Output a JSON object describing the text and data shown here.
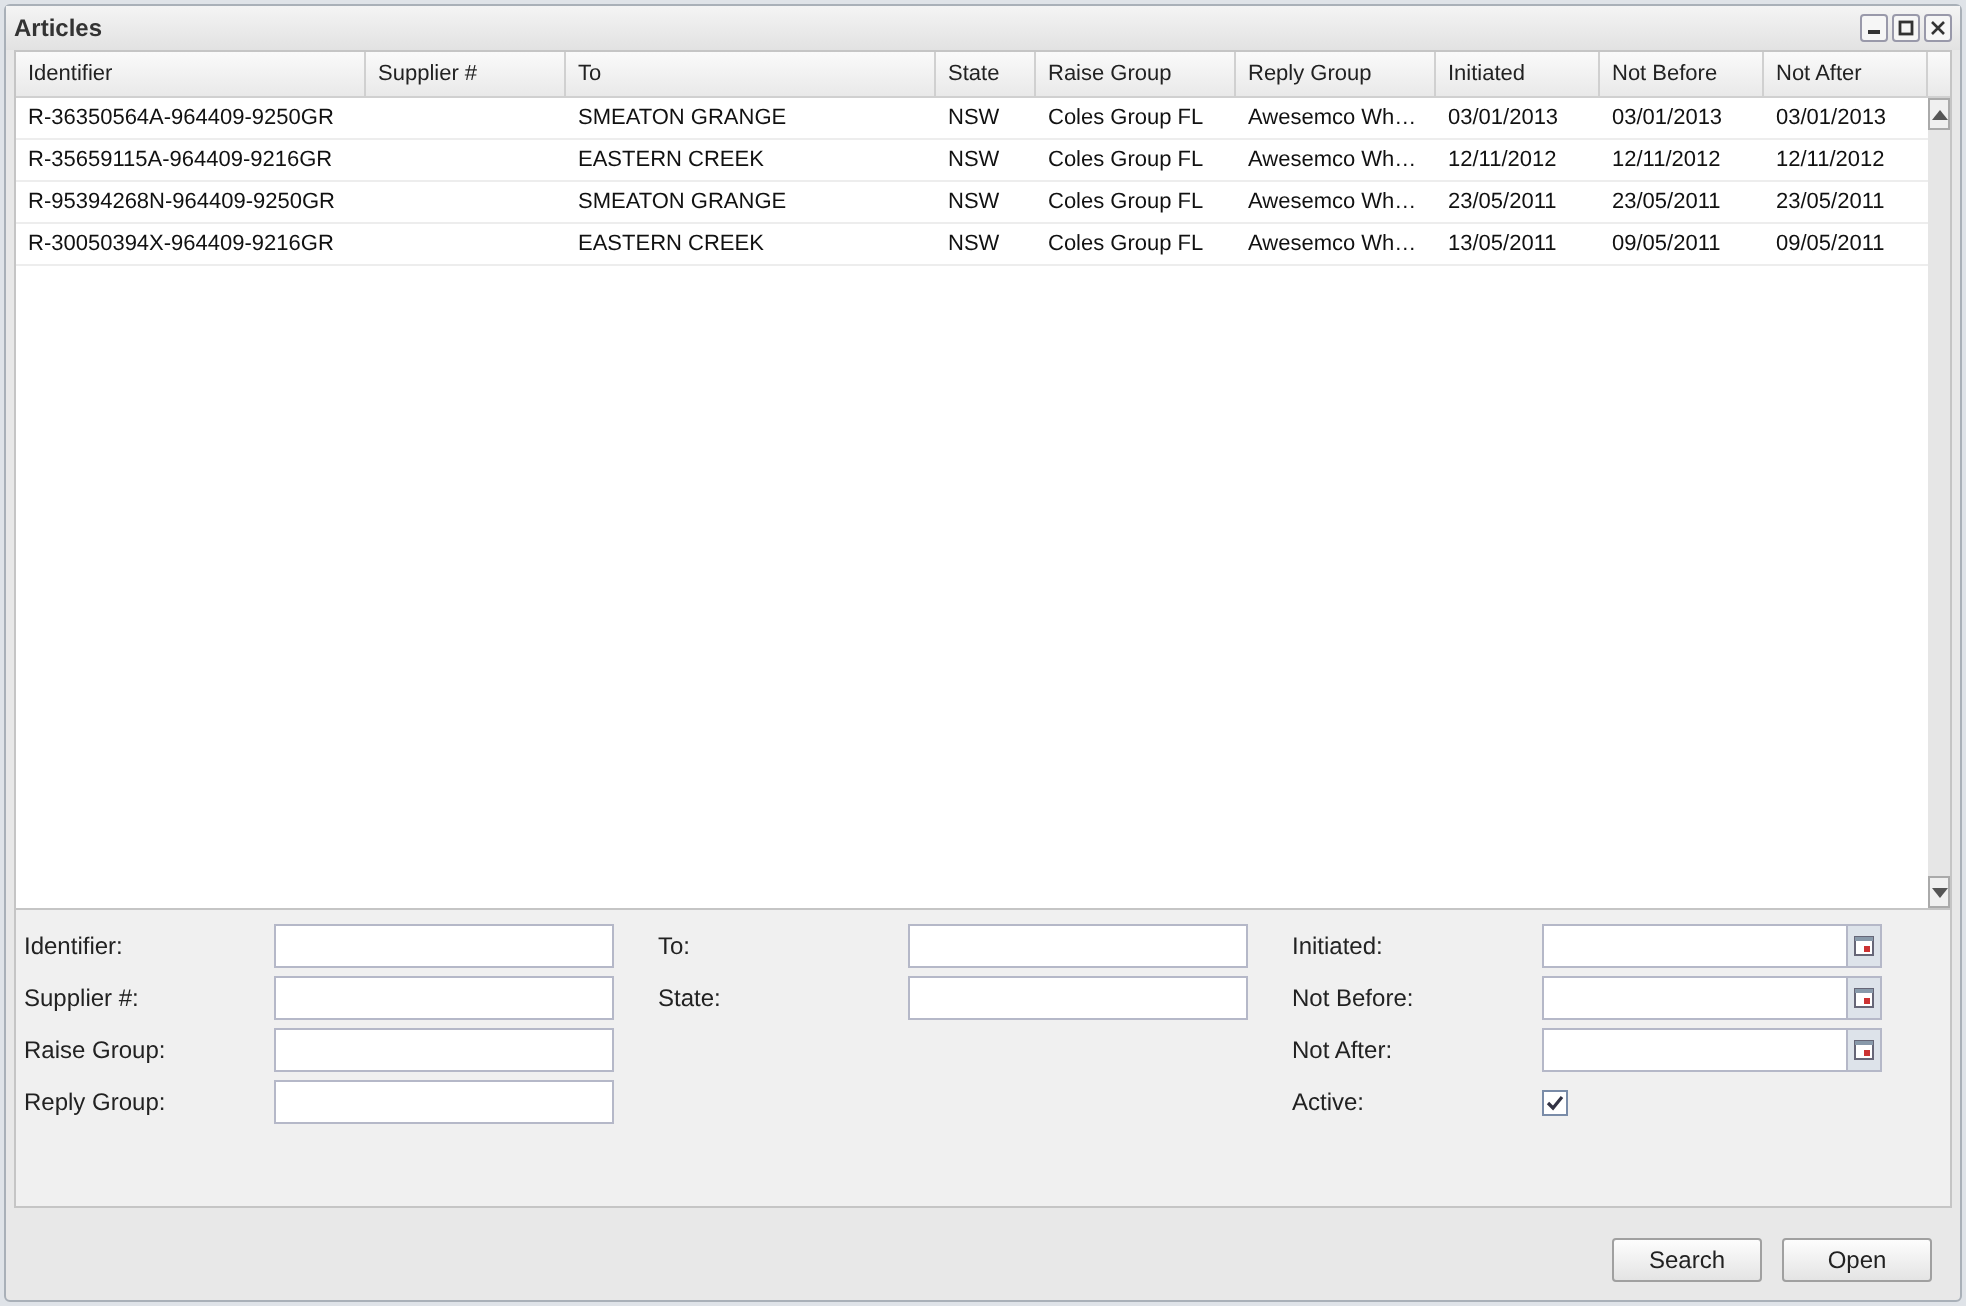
{
  "window": {
    "title": "Articles"
  },
  "table": {
    "columns": [
      "Identifier",
      "Supplier #",
      "To",
      "State",
      "Raise Group",
      "Reply Group",
      "Initiated",
      "Not Before",
      "Not After"
    ],
    "rows": [
      [
        "R-36350564A-964409-9250GR",
        "",
        "SMEATON GRANGE",
        "NSW",
        "Coles Group FL",
        "Awesemco Wh…",
        "03/01/2013",
        "03/01/2013",
        "03/01/2013"
      ],
      [
        "R-35659115A-964409-9216GR",
        "",
        "EASTERN CREEK",
        "NSW",
        "Coles Group FL",
        "Awesemco Wh…",
        "12/11/2012",
        "12/11/2012",
        "12/11/2012"
      ],
      [
        "R-95394268N-964409-9250GR",
        "",
        "SMEATON GRANGE",
        "NSW",
        "Coles Group FL",
        "Awesemco Wh…",
        "23/05/2011",
        "23/05/2011",
        "23/05/2011"
      ],
      [
        "R-30050394X-964409-9216GR",
        "",
        "EASTERN CREEK",
        "NSW",
        "Coles Group FL",
        "Awesemco Wh…",
        "13/05/2011",
        "09/05/2011",
        "09/05/2011"
      ]
    ]
  },
  "filter_columns": [
    {
      "fields": [
        {
          "label": "Identifier:",
          "kind": "text"
        },
        {
          "label": "Supplier #:",
          "kind": "text"
        },
        {
          "label": "Raise Group:",
          "kind": "text"
        },
        {
          "label": "Reply Group:",
          "kind": "text"
        }
      ]
    },
    {
      "fields": [
        {
          "label": "To:",
          "kind": "text"
        },
        {
          "label": "State:",
          "kind": "text"
        }
      ]
    },
    {
      "fields": [
        {
          "label": "Initiated:",
          "kind": "date"
        },
        {
          "label": "Not Before:",
          "kind": "date"
        },
        {
          "label": "Not After:",
          "kind": "date"
        },
        {
          "label": "Active:",
          "kind": "checkbox",
          "checked": true
        }
      ]
    }
  ],
  "buttons": [
    "Search",
    "Open"
  ]
}
